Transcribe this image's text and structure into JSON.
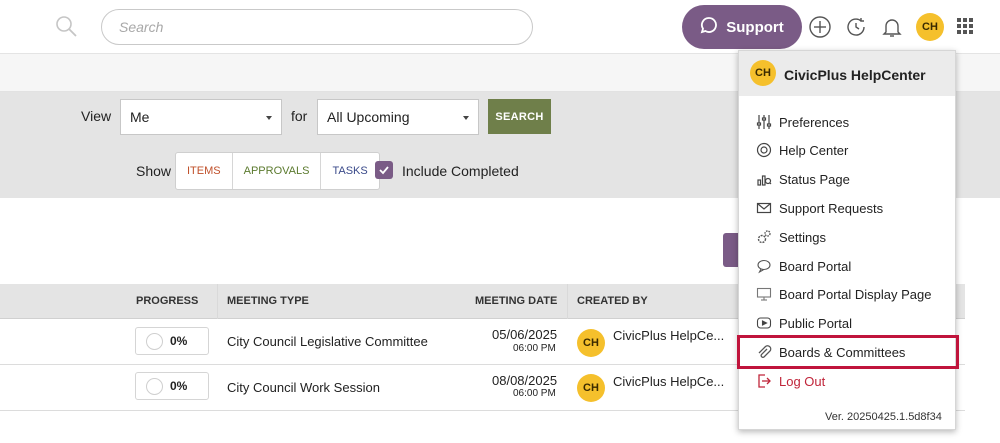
{
  "header": {
    "search_placeholder": "Search",
    "support_label": "Support",
    "user_initials": "CH"
  },
  "filter": {
    "view_label": "View",
    "view_value": "Me",
    "for_label": "for",
    "for_value": "All Upcoming",
    "search_button": "SEARCH",
    "show_label": "Show",
    "segments": [
      "ITEMS",
      "APPROVALS",
      "TASKS"
    ],
    "include_completed": "Include Completed",
    "include_completed_checked": true
  },
  "table": {
    "headers": {
      "progress": "PROGRESS",
      "meeting_type": "MEETING TYPE",
      "meeting_date": "MEETING DATE",
      "created_by": "CREATED BY"
    },
    "rows": [
      {
        "progress": "0%",
        "meeting_type": "City Council Legislative Committee",
        "date": "05/06/2025",
        "time": "06:00 PM",
        "creator_initials": "CH",
        "creator": "CivicPlus HelpCe..."
      },
      {
        "progress": "0%",
        "meeting_type": "City Council Work Session",
        "date": "08/08/2025",
        "time": "06:00 PM",
        "creator_initials": "CH",
        "creator": "CivicPlus HelpCe..."
      }
    ]
  },
  "menu": {
    "initials": "CH",
    "title": "CivicPlus HelpCenter",
    "items": [
      {
        "label": "Preferences",
        "icon": "sliders-icon"
      },
      {
        "label": "Help Center",
        "icon": "lifebuoy-icon"
      },
      {
        "label": "Status Page",
        "icon": "status-chart-icon"
      },
      {
        "label": "Support Requests",
        "icon": "envelope-icon"
      },
      {
        "label": "Settings",
        "icon": "gears-icon"
      },
      {
        "label": "Board Portal",
        "icon": "chat-bubble-icon"
      },
      {
        "label": "Board Portal Display Page",
        "icon": "monitor-icon"
      },
      {
        "label": "Public Portal",
        "icon": "play-screen-icon"
      },
      {
        "label": "Boards & Committees",
        "icon": "paperclip-icon"
      },
      {
        "label": "Log Out",
        "icon": "logout-icon"
      }
    ],
    "version": "Ver. 20250425.1.5d8f34"
  },
  "colors": {
    "brand_purple": "#7a5b86",
    "search_green": "#6f7f4a",
    "avatar_yellow": "#f5c02c",
    "highlight_red": "#c0143c",
    "items_color": "#c0502a",
    "approvals_color": "#5b7a2e",
    "tasks_color": "#3a4a8a"
  }
}
